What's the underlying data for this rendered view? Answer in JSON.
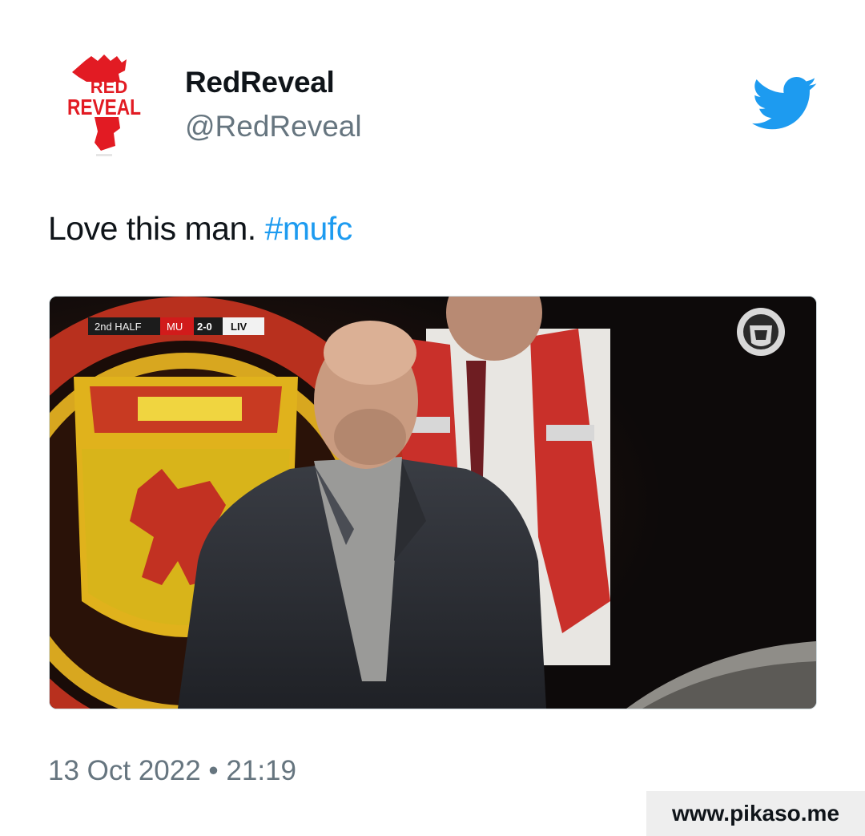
{
  "author": {
    "display_name": "RedReveal",
    "handle": "@RedReveal",
    "avatar_text_line1": "RED",
    "avatar_text_line2": "REVEAL",
    "avatar_color": "#e21b23"
  },
  "tweet": {
    "text": "Love this man.",
    "hashtag": "#mufc",
    "hashtag_color": "#1d9bf0",
    "timestamp": "13 Oct 2022 • 21:19"
  },
  "media": {
    "type": "gif",
    "scoreboard": {
      "period": "2nd HALF",
      "home": "MU",
      "score": "2-0",
      "away": "LIV"
    }
  },
  "icons": {
    "brand": "twitter-bird-icon",
    "brand_color": "#1d9bf0"
  },
  "watermark": {
    "text": "www.pikaso.me"
  }
}
